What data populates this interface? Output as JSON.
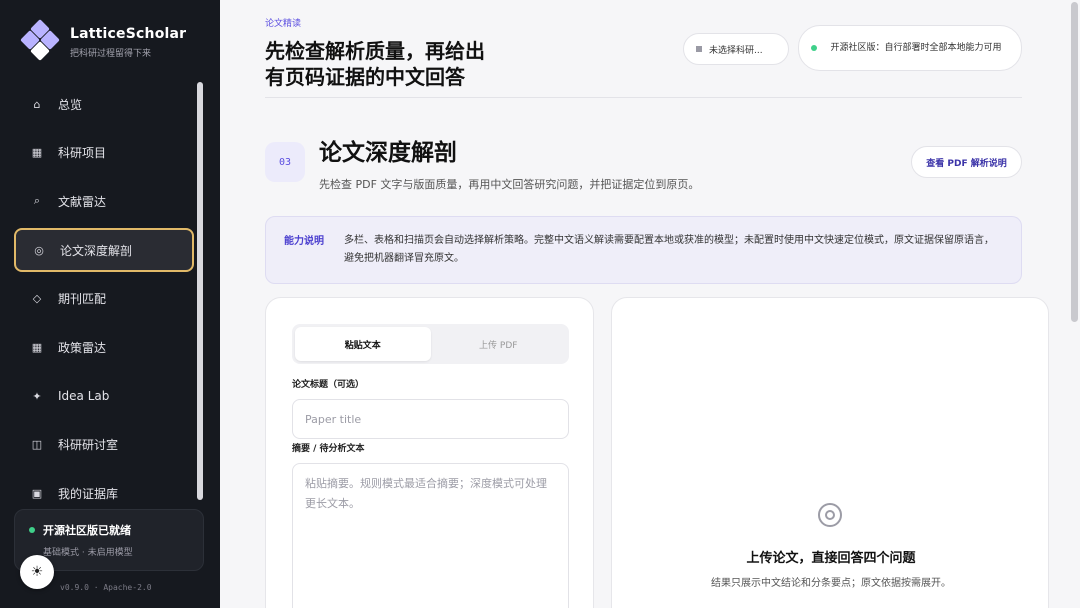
{
  "app": {
    "name": "LatticeScholar",
    "tagline": "把科研过程留得下来",
    "version": "v0.9.0 · Apache-2.0"
  },
  "sidebar": {
    "items": [
      {
        "label": "总览",
        "icon": "home-icon",
        "glyph": "⌂",
        "active": false
      },
      {
        "label": "科研项目",
        "icon": "grid-icon",
        "glyph": "▦",
        "active": false
      },
      {
        "label": "文献雷达",
        "icon": "search-icon",
        "glyph": "⌕",
        "active": false
      },
      {
        "label": "论文深度解剖",
        "icon": "target-icon",
        "glyph": "◎",
        "active": true
      },
      {
        "label": "期刊匹配",
        "icon": "diamond-icon",
        "glyph": "◇",
        "active": false
      },
      {
        "label": "政策雷达",
        "icon": "grid-icon",
        "glyph": "▦",
        "active": false
      },
      {
        "label": "Idea Lab",
        "icon": "sparkle-icon",
        "glyph": "✦",
        "active": false
      },
      {
        "label": "科研研讨室",
        "icon": "columns-icon",
        "glyph": "◫",
        "active": false
      },
      {
        "label": "我的证据库",
        "icon": "box-icon",
        "glyph": "▣",
        "active": false
      }
    ],
    "status": {
      "title": "开源社区版已就绪",
      "subtitle": "基础模式 · 未启用模型"
    },
    "theme_icon": "☀"
  },
  "header": {
    "eyebrow": "论文精读",
    "title_line1": "先检查解析质量，再给出",
    "title_line2": "有页码证据的中文回答",
    "project_chip": "未选择科研...",
    "community_chip": "开源社区版：自行部署时全部本地能力可用"
  },
  "section": {
    "number": "03",
    "title": "论文深度解剖",
    "description": "先检查 PDF 文字与版面质量，再用中文回答研究问题，并把证据定位到原页。",
    "pdf_button": "查看 PDF 解析说明"
  },
  "info": {
    "label": "能力说明",
    "text": "多栏、表格和扫描页会自动选择解析策略。完整中文语义解读需要配置本地或获准的模型；未配置时使用中文快速定位模式，原文证据保留原语言，避免把机器翻译冒充原文。"
  },
  "form": {
    "tabs": [
      "粘贴文本",
      "上传 PDF"
    ],
    "active_tab": 0,
    "title_label": "论文标题（可选）",
    "title_placeholder": "Paper title",
    "abstract_label": "摘要 / 待分析文本",
    "abstract_placeholder": "粘贴摘要。规则模式最适合摘要；深度模式可处理更长文本。"
  },
  "result": {
    "empty_title": "上传论文，直接回答四个问题",
    "empty_description": "结果只展示中文结论和分条要点；原文依据按需展开。"
  },
  "colors": {
    "accent": "#5b4ee0",
    "active_border": "#e1b968",
    "sidebar_bg": "#16191f",
    "status_green": "#3fd08a"
  }
}
